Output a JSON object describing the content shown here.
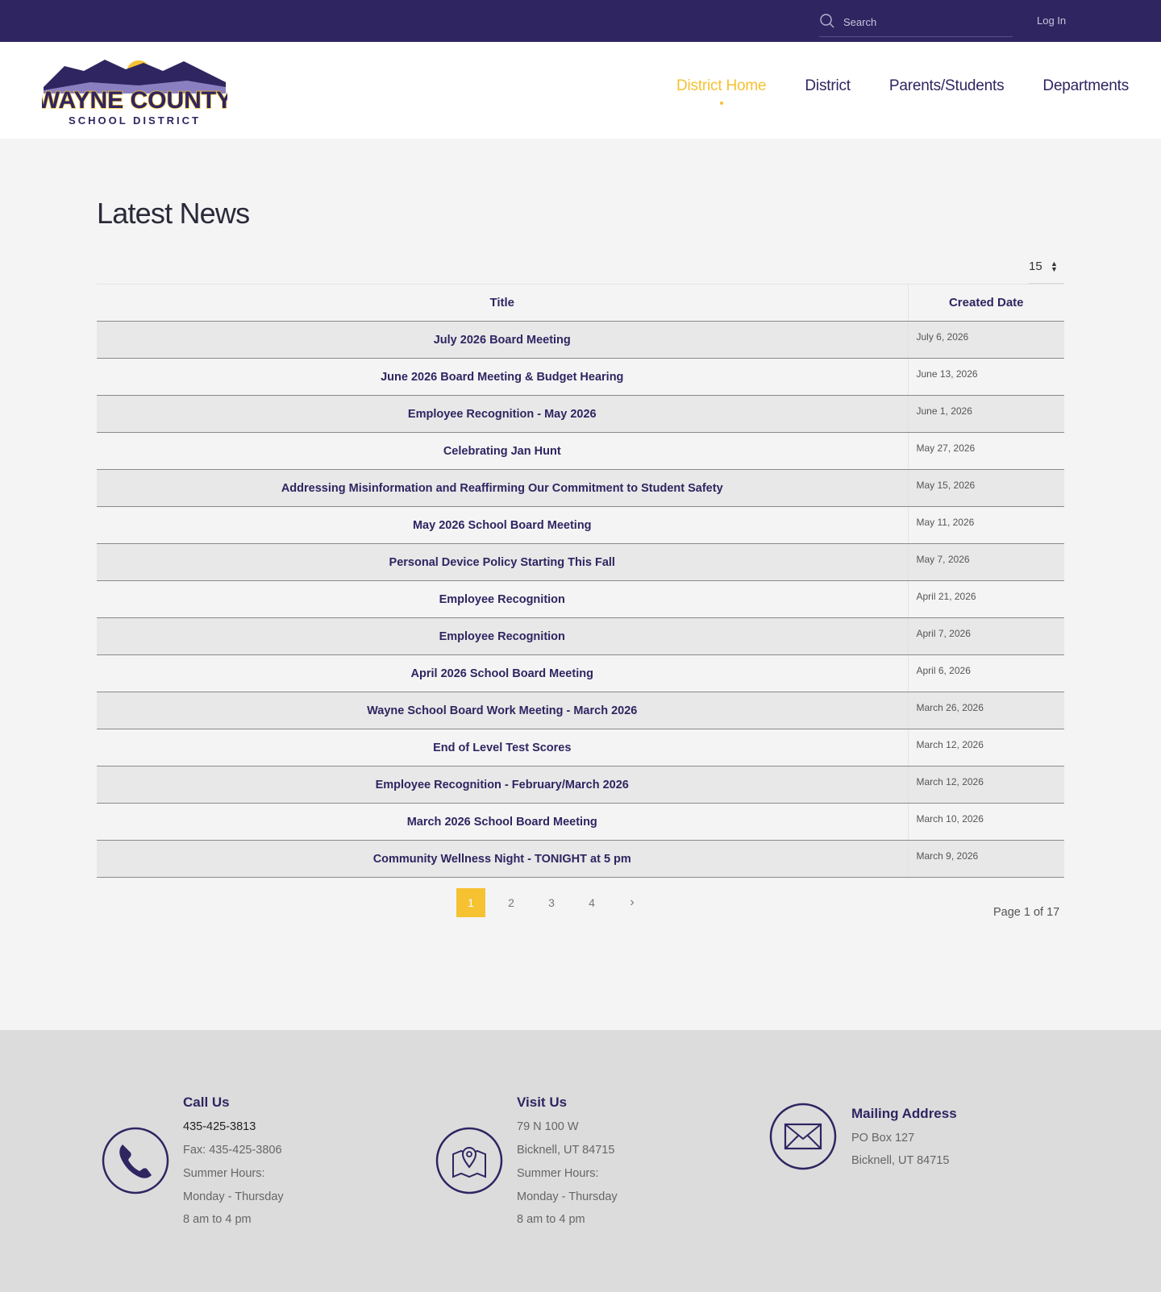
{
  "topbar": {
    "search_placeholder": "Search",
    "login_label": "Log In"
  },
  "logo": {
    "line1": "WAYNE COUNTY",
    "line2": "SCHOOL DISTRICT"
  },
  "nav": {
    "items": [
      {
        "label": "District Home",
        "active": true
      },
      {
        "label": "District",
        "active": false
      },
      {
        "label": "Parents/Students",
        "active": false
      },
      {
        "label": "Departments",
        "active": false
      }
    ]
  },
  "main": {
    "title": "Latest News",
    "per_page": "15",
    "columns": {
      "title": "Title",
      "date": "Created Date"
    },
    "rows": [
      {
        "title": "July 2026 Board Meeting",
        "date": "July 6, 2026"
      },
      {
        "title": "June 2026 Board Meeting & Budget Hearing",
        "date": "June 13, 2026"
      },
      {
        "title": "Employee Recognition - May 2026",
        "date": "June 1, 2026"
      },
      {
        "title": "Celebrating Jan Hunt",
        "date": "May 27, 2026"
      },
      {
        "title": "Addressing Misinformation and Reaffirming Our Commitment to Student Safety",
        "date": "May 15, 2026"
      },
      {
        "title": "May 2026 School Board Meeting",
        "date": "May 11, 2026"
      },
      {
        "title": "Personal Device Policy Starting This Fall",
        "date": "May 7, 2026"
      },
      {
        "title": "Employee Recognition",
        "date": "April 21, 2026"
      },
      {
        "title": "Employee Recognition",
        "date": "April 7, 2026"
      },
      {
        "title": "April 2026 School Board Meeting",
        "date": "April 6, 2026"
      },
      {
        "title": "Wayne School Board Work Meeting - March 2026",
        "date": "March 26, 2026"
      },
      {
        "title": "End of Level Test Scores",
        "date": "March 12, 2026"
      },
      {
        "title": "Employee Recognition - February/March 2026",
        "date": "March 12, 2026"
      },
      {
        "title": "March 2026 School Board Meeting",
        "date": "March 10, 2026"
      },
      {
        "title": "Community Wellness Night - TONIGHT at 5 pm",
        "date": "March 9, 2026"
      }
    ],
    "pagination": {
      "pages": [
        "1",
        "2",
        "3",
        "4"
      ],
      "current": "1",
      "next": "›",
      "summary": "Page 1 of 17"
    }
  },
  "footer": {
    "call": {
      "title": "Call Us",
      "phone": "435-425-3813",
      "fax": "Fax: 435-425-3806",
      "hours_label": "Summer Hours:",
      "days": "Monday - Thursday",
      "time": "8 am to 4 pm"
    },
    "visit": {
      "title": "Visit Us",
      "street": "79 N 100 W",
      "city": "Bicknell, UT 84715",
      "hours_label": "Summer Hours:",
      "days": "Monday - Thursday",
      "time": "8 am to 4 pm"
    },
    "mail": {
      "title": "Mailing Address",
      "box": "PO Box 127",
      "city": "Bicknell, UT 84715"
    }
  },
  "colors": {
    "brand_purple": "#2f2561",
    "accent_gold": "#f6c232"
  }
}
